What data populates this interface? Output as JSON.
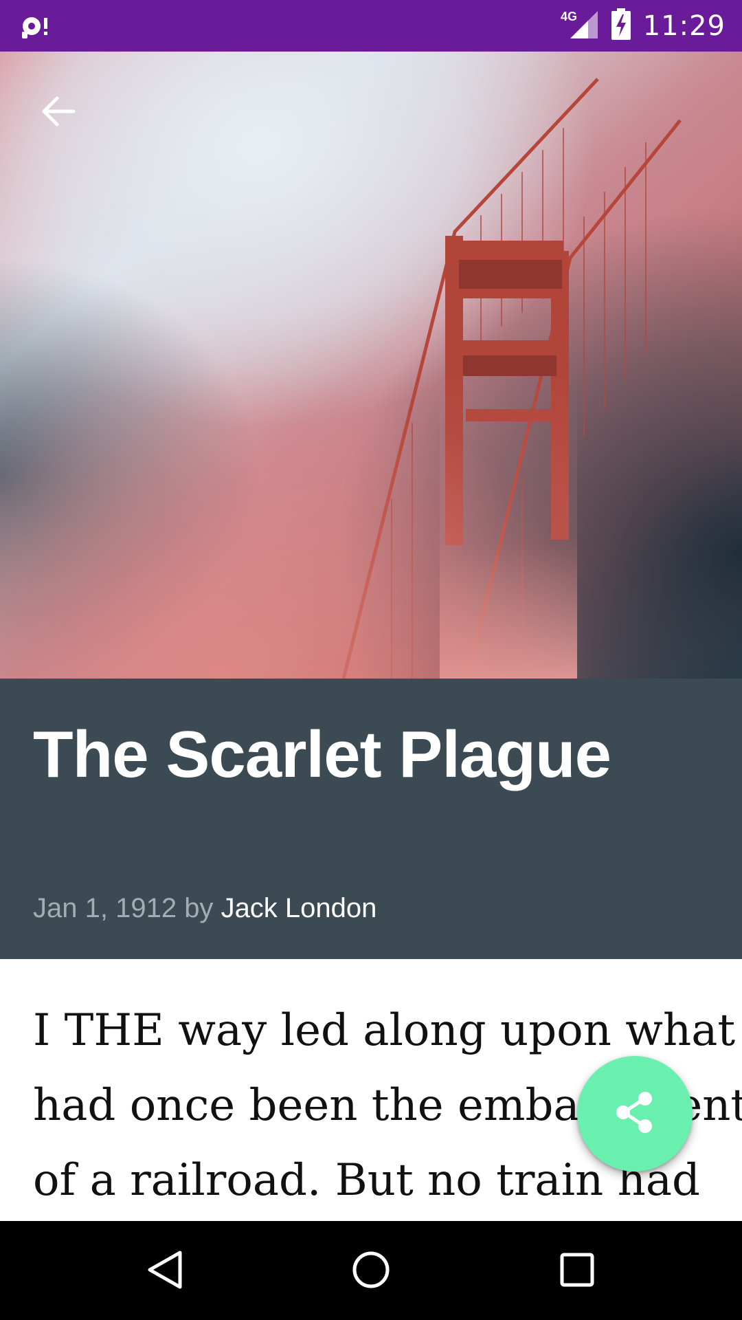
{
  "status_bar": {
    "time": "11:29",
    "network": "4G",
    "background": "#6a1b9a",
    "icons": [
      "notification-icon",
      "signal-icon",
      "battery-charging-icon"
    ]
  },
  "toolbar": {
    "back_icon": "arrow-back-icon"
  },
  "hero": {
    "description_icon": "bridge-in-fog-image"
  },
  "article": {
    "title": "The Scarlet Plague",
    "date": "Jan 1, 1912",
    "by": "by",
    "author": "Jack London",
    "header_background": "#3b4a53",
    "body_lines": [
      "I THE way led along upon what",
      "had once been the embankment",
      "of a railroad. But no train had"
    ]
  },
  "fab": {
    "icon": "share-icon",
    "color": "#69f0ae"
  },
  "nav_bar": {
    "back_icon": "nav-back-icon",
    "home_icon": "nav-home-icon",
    "recents_icon": "nav-recents-icon"
  }
}
